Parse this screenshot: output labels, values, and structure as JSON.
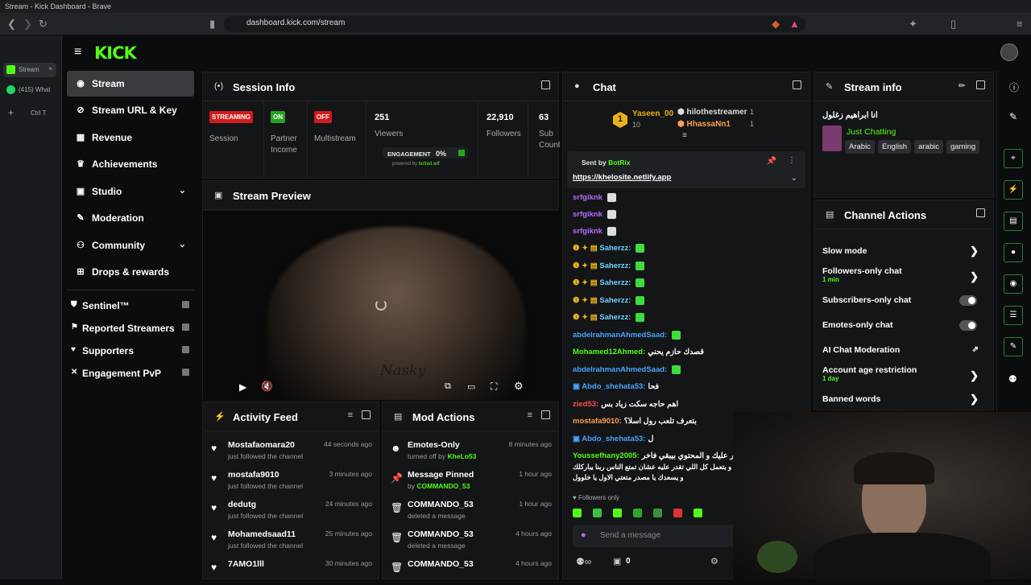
{
  "browser": {
    "window_title": "Stream - Kick Dashboard - Brave",
    "url": "dashboard.kick.com/stream",
    "tabs": [
      "Stream",
      "(415) What"
    ],
    "shortcut": "Ctrl T"
  },
  "brand": {
    "logo": "KICK",
    "accent": "#53fc18"
  },
  "nav": {
    "items": [
      {
        "label": "Stream",
        "icon": "broadcast-icon"
      },
      {
        "label": "Stream URL & Key",
        "icon": "link-icon"
      },
      {
        "label": "Revenue",
        "icon": "revenue-icon"
      },
      {
        "label": "Achievements",
        "icon": "trophy-icon"
      },
      {
        "label": "Studio",
        "icon": "studio-icon"
      },
      {
        "label": "Moderation",
        "icon": "wrench-icon"
      },
      {
        "label": "Community",
        "icon": "community-icon"
      },
      {
        "label": "Drops & rewards",
        "icon": "gift-icon"
      }
    ],
    "secondary": [
      {
        "label": "Sentinel™"
      },
      {
        "label": "Reported Streamers"
      },
      {
        "label": "Supporters"
      },
      {
        "label": "Engagement PvP"
      }
    ]
  },
  "session": {
    "title": "Session Info",
    "session_badge": "STREAMING",
    "session_label": "Session",
    "partner_badge": "ON",
    "partner_label": "Partner Income",
    "multistream_badge": "OFF",
    "multistream_label": "Multistream",
    "viewers_value": "251",
    "viewers_label": "Viewers",
    "engagement_label": "ENGAGEMENT",
    "engagement_value": "0%",
    "powered_by": "powered by",
    "powered_site": "botted.wtf",
    "followers_value": "22,910",
    "followers_label": "Followers",
    "subs_value": "63",
    "subs_label": "Sub Count"
  },
  "preview": {
    "title": "Stream Preview",
    "overlay_text": "Nasky"
  },
  "activity": {
    "title": "Activity Feed",
    "items": [
      {
        "name": "Mostafaomara20",
        "sub": "just followed the channel",
        "time": "44 seconds ago"
      },
      {
        "name": "mostafa9010",
        "sub": "just followed the channel",
        "time": "3 minutes ago"
      },
      {
        "name": "dedutg",
        "sub": "just followed the channel",
        "time": "24 minutes ago"
      },
      {
        "name": "Mohamedsaad11",
        "sub": "just followed the channel",
        "time": "25 minutes ago"
      },
      {
        "name": "7AMO1lll",
        "sub": "",
        "time": "30 minutes ago"
      }
    ]
  },
  "modactions": {
    "title": "Mod Actions",
    "items": [
      {
        "name": "Emotes-Only",
        "sub": "turned off by",
        "by": "KheLo53",
        "time": "8 minutes ago"
      },
      {
        "name": "Message Pinned",
        "sub": "by",
        "by": "COMMANDO_53",
        "time": "1 hour ago"
      },
      {
        "name": "COMMANDO_53",
        "sub": "deleted a message",
        "by": "",
        "time": "1 hour ago"
      },
      {
        "name": "COMMANDO_53",
        "sub": "deleted a message",
        "by": "",
        "time": "4 hours ago"
      },
      {
        "name": "COMMANDO_53",
        "sub": "",
        "by": "",
        "time": "4 hours ago"
      }
    ]
  },
  "chat": {
    "title": "Chat",
    "top_gifters": [
      {
        "rank": "1",
        "name": "Yaseen_00",
        "count": "10"
      },
      {
        "rank": "",
        "name": "hilothestreamer",
        "count": "1"
      },
      {
        "rank": "",
        "name": "HhassaNn1",
        "count": "1"
      }
    ],
    "pinned_sent_by": "Sent by",
    "pinned_user": "BotRix",
    "pinned_link": "https://khelosite.netlify.app",
    "messages": [
      {
        "user": "srfgiknk",
        "text": "",
        "color": "#b36cff"
      },
      {
        "user": "srfgiknk",
        "text": "",
        "color": "#b36cff"
      },
      {
        "user": "srfgiknk",
        "text": "",
        "color": "#b36cff"
      },
      {
        "user": "Saherzz:",
        "text": "",
        "color": "#6cd3ff"
      },
      {
        "user": "Saherzz:",
        "text": "",
        "color": "#6cd3ff"
      },
      {
        "user": "Saherzz:",
        "text": "",
        "color": "#6cd3ff"
      },
      {
        "user": "Saherzz:",
        "text": "",
        "color": "#6cd3ff"
      },
      {
        "user": "Saherzz:",
        "text": "",
        "color": "#6cd3ff"
      },
      {
        "user": "abdelrahmanAhmedSaad:",
        "text": "",
        "color": "#4aa3ff"
      },
      {
        "user": "Mohamed12Ahmed:",
        "text": "قصدك حازم يحني",
        "color": "#53fc18"
      },
      {
        "user": "abdelrahmanAhmedSaad:",
        "text": "",
        "color": "#4aa3ff"
      },
      {
        "user": "Abdo_shehata53:",
        "text": "فحا",
        "color": "#4aa3ff"
      },
      {
        "user": "zied53:",
        "text": "اهم حاجه سكت زياد بس",
        "color": "#ff4d4d"
      },
      {
        "user": "mostafa9010:",
        "text": "بتعرف تلعب رول اسلا؟",
        "color": "#ff9d4d"
      },
      {
        "user": "Abdo_shehata53:",
        "text": "ل",
        "color": "#4aa3ff"
      },
      {
        "user": "Youssefhany2005:",
        "text": "بداية خير عليك و المحتوي بيبقي فاخر",
        "color": "#53fc18"
      }
    ],
    "wrapped_lines": [
      "امانة و بتعمل كل اللي تقدر عليه عشان تمتع الناس ربنا يباركلك",
      "و يسعدك يا مصدر متعتي الاول يا خلوول"
    ],
    "followers_only": "Followers only",
    "input_placeholder": "Send a message",
    "points": "0"
  },
  "streaminfo": {
    "title": "Stream info",
    "stream_title": "انا ابراهيم زغلول",
    "category": "Just Chatting",
    "tags": [
      "Arabic",
      "English",
      "arabic",
      "gaming"
    ]
  },
  "channel_actions": {
    "title": "Channel Actions",
    "items": [
      {
        "label": "Slow mode",
        "sub": "",
        "control": "chevron"
      },
      {
        "label": "Followers-only chat",
        "sub": "1 min",
        "control": "chevron"
      },
      {
        "label": "Subscribers-only chat",
        "sub": "",
        "control": "toggle"
      },
      {
        "label": "Emotes-only chat",
        "sub": "",
        "control": "toggle"
      },
      {
        "label": "AI Chat Moderation",
        "sub": "",
        "control": "external"
      },
      {
        "label": "Account age restriction",
        "sub": "1 day",
        "control": "chevron"
      },
      {
        "label": "Banned words",
        "sub": "",
        "control": "chevron"
      }
    ]
  }
}
